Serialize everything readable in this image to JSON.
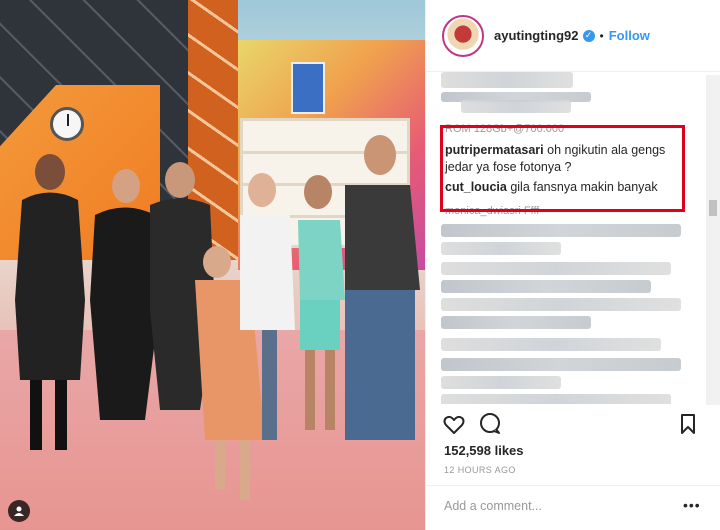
{
  "post": {
    "username": "ayutingting92",
    "follow_label": "Follow",
    "separator": "•",
    "likes": "152,598 likes",
    "time": "12 HOURS AGO",
    "comment_placeholder": "Add a comment...",
    "more_label": "•••"
  },
  "comments": {
    "partial_top": "ROM 128Gb+@700.000",
    "items": [
      {
        "user": "putripermatasari",
        "text": "oh ngikutin ala gengs",
        "text2": "jedar ya fose fotonya ?"
      },
      {
        "user": "cut_loucia",
        "text": "gila fansnya makin banyak"
      }
    ],
    "partial_bottom": "monica_dwiasri Ffff"
  },
  "colors": {
    "accent": "#3897f0",
    "highlight": "#e0001b",
    "text": "#262626",
    "muted": "#999999"
  },
  "icons": [
    "verified-badge-icon",
    "heart-icon",
    "comment-icon",
    "bookmark-icon",
    "user-tag-icon",
    "more-icon"
  ]
}
